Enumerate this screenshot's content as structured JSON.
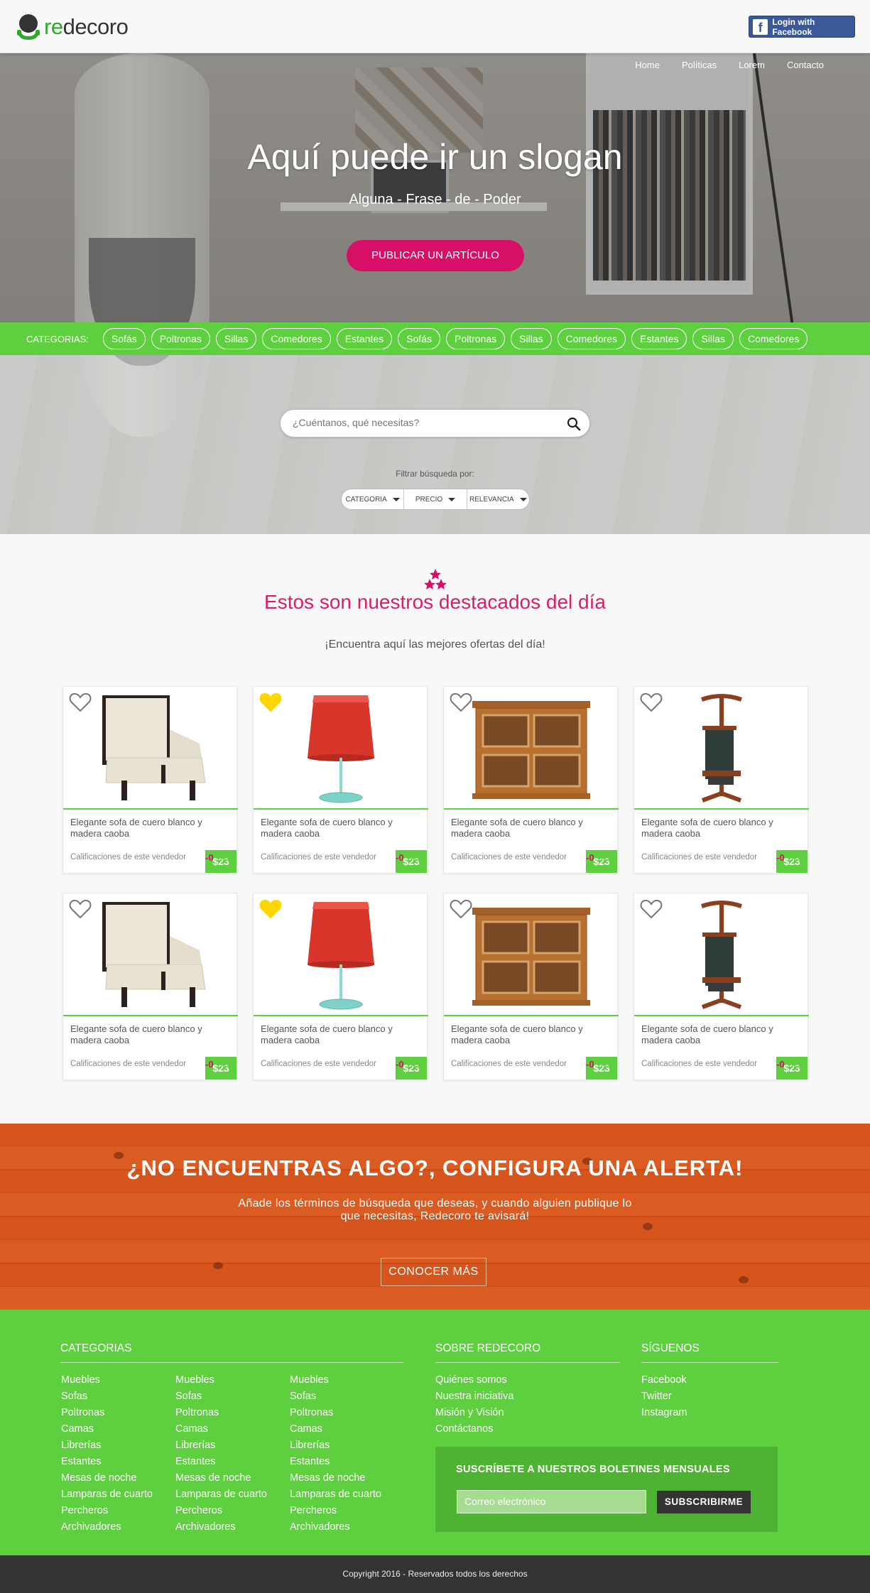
{
  "header": {
    "logo_prefix": "re",
    "logo_suffix": "decoro",
    "fb_login": "Login with Facebook"
  },
  "nav": [
    "Home",
    "Políticas",
    "Lorem",
    "Contacto"
  ],
  "hero": {
    "slogan": "Aquí puede ir un slogan",
    "subslogan": "Alguna - Frase - de - Poder",
    "publish_button": "PUBLICAR UN ARTÍCULO"
  },
  "categories": {
    "label": "CATEGORIAS:",
    "items": [
      "Sofás",
      "Poltronas",
      "Sillas",
      "Comedores",
      "Estantes",
      "Sofás",
      "Poltronas",
      "Sillas",
      "Comedores",
      "Estantes",
      "Sillas",
      "Comedores"
    ]
  },
  "search": {
    "placeholder": "¿Cuéntanos, qué necesitas?",
    "filter_label": "Filtrar búsqueda por:",
    "filters": [
      "CATEGORIA",
      "PRECIO",
      "RELEVANCIA"
    ]
  },
  "featured": {
    "title": "Estos son nuestros destacados del día",
    "subtitle": "¡Encuentra aquí las mejores ofertas del día!",
    "products": [
      {
        "image": "armchair",
        "favorited": false,
        "price": "$23",
        "title": "Elegante sofa de cuero blanco y madera caoba",
        "rating_label": "Calificaciones de este vendedor",
        "neg": "-0",
        "pos": "+5"
      },
      {
        "image": "lamp",
        "favorited": true,
        "price": "$23",
        "title": "Elegante sofa de cuero blanco y madera caoba",
        "rating_label": "Calificaciones de este vendedor",
        "neg": "-0",
        "pos": "+5"
      },
      {
        "image": "cabinet",
        "favorited": false,
        "price": "$23",
        "title": "Elegante sofa de cuero blanco y madera caoba",
        "rating_label": "Calificaciones de este vendedor",
        "neg": "-0",
        "pos": "+5"
      },
      {
        "image": "valet-stand",
        "favorited": false,
        "price": "$23",
        "title": "Elegante sofa de cuero blanco y madera caoba",
        "rating_label": "Calificaciones de este vendedor",
        "neg": "-0",
        "pos": "+5"
      },
      {
        "image": "armchair",
        "favorited": false,
        "price": "$23",
        "title": "Elegante sofa de cuero blanco y madera caoba",
        "rating_label": "Calificaciones de este vendedor",
        "neg": "-0",
        "pos": "+5"
      },
      {
        "image": "lamp",
        "favorited": true,
        "price": "$23",
        "title": "Elegante sofa de cuero blanco y madera caoba",
        "rating_label": "Calificaciones de este vendedor",
        "neg": "-0",
        "pos": "+5"
      },
      {
        "image": "cabinet",
        "favorited": false,
        "price": "$23",
        "title": "Elegante sofa de cuero blanco y madera caoba",
        "rating_label": "Calificaciones de este vendedor",
        "neg": "-0",
        "pos": "+5"
      },
      {
        "image": "valet-stand",
        "favorited": false,
        "price": "$23",
        "title": "Elegante sofa de cuero blanco y madera caoba",
        "rating_label": "Calificaciones de este vendedor",
        "neg": "-0",
        "pos": "+5"
      }
    ]
  },
  "alert": {
    "title": "¿NO ENCUENTRAS ALGO?, CONFIGURA UNA ALERTA!",
    "description": "Añade los términos de búsqueda que deseas, y cuando alguien publique lo que necesitas, Redecoro te avisará!",
    "button": "CONOCER MÁS"
  },
  "footer": {
    "categories_title": "CATEGORIAS",
    "category_links": [
      "Muebles",
      "Sofas",
      "Poltronas",
      "Camas",
      "Librerías",
      "Estantes",
      "Mesas de noche",
      "Lamparas de cuarto",
      "Percheros",
      "Archivadores"
    ],
    "about_title": "SOBRE REDECORO",
    "about_links": [
      "Quiénes somos",
      "Nuestra iniciativa",
      "Misión y Visión",
      "Contáctanos"
    ],
    "follow_title": "SÍGUENOS",
    "follow_links": [
      "Facebook",
      "Twitter",
      "Instagram"
    ],
    "newsletter_title": "SUSCRÍBETE A NUESTROS BOLETINES MENSUALES",
    "newsletter_placeholder": "Correo electrónico",
    "newsletter_button": "SUBSCRIBIRME",
    "copyright": "Copyright 2016 - Reservados todos los derechos"
  },
  "colors": {
    "brand_green": "#5ecf3e",
    "accent_pink": "#d80f66",
    "facebook_blue": "#3b5998",
    "dark": "#333333"
  }
}
